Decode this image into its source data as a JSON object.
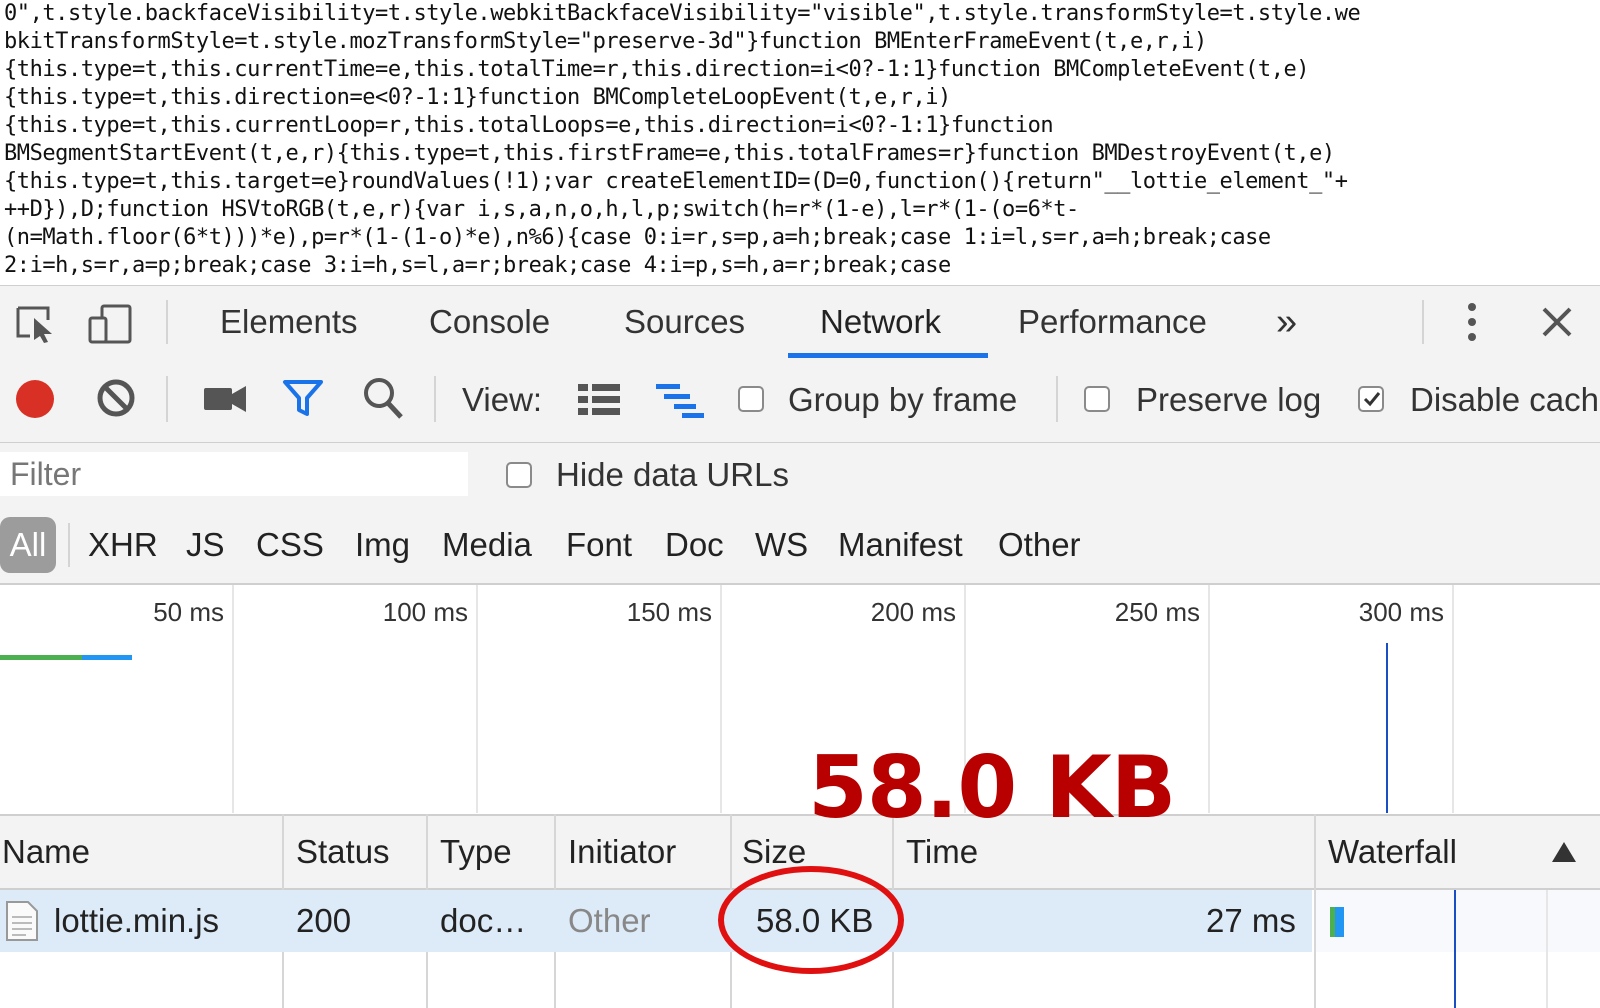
{
  "code_lines": [
    "0\",t.style.backfaceVisibility=t.style.webkitBackfaceVisibility=\"visible\",t.style.transformStyle=t.style.we",
    "bkitTransformStyle=t.style.mozTransformStyle=\"preserve-3d\"}function BMEnterFrameEvent(t,e,r,i)",
    "{this.type=t,this.currentTime=e,this.totalTime=r,this.direction=i<0?-1:1}function BMCompleteEvent(t,e)",
    "{this.type=t,this.direction=e<0?-1:1}function BMCompleteLoopEvent(t,e,r,i)",
    "{this.type=t,this.currentLoop=r,this.totalLoops=e,this.direction=i<0?-1:1}function",
    "BMSegmentStartEvent(t,e,r){this.type=t,this.firstFrame=e,this.totalFrames=r}function BMDestroyEvent(t,e)",
    "{this.type=t,this.target=e}roundValues(!1);var createElementID=(D=0,function(){return\"__lottie_element_\"+",
    "++D}),D;function HSVtoRGB(t,e,r){var i,s,a,n,o,h,l,p;switch(h=r*(1-e),l=r*(1-(o=6*t-",
    "(n=Math.floor(6*t)))*e),p=r*(1-(1-o)*e),n%6){case 0:i=r,s=p,a=h;break;case 1:i=l,s=r,a=h;break;case",
    "2:i=h,s=r,a=p;break;case 3:i=h,s=l,a=r;break;case 4:i=p,s=h,a=r;break;case"
  ],
  "devtools": {
    "tabs": [
      "Elements",
      "Console",
      "Sources",
      "Network",
      "Performance"
    ],
    "active_tab": "Network",
    "more_tabs_glyph": "»"
  },
  "toolbar": {
    "view_label": "View:",
    "group_by_frame": "Group by frame",
    "preserve_log": "Preserve log",
    "disable_cache": "Disable cach",
    "disable_cache_checked": true
  },
  "filter": {
    "placeholder": "Filter",
    "hide_data_urls": "Hide data URLs"
  },
  "type_filters": [
    "All",
    "XHR",
    "JS",
    "CSS",
    "Img",
    "Media",
    "Font",
    "Doc",
    "WS",
    "Manifest",
    "Other"
  ],
  "timeline": {
    "ticks": [
      "50 ms",
      "100 ms",
      "150 ms",
      "200 ms",
      "250 ms",
      "300 ms"
    ]
  },
  "table": {
    "columns": [
      "Name",
      "Status",
      "Type",
      "Initiator",
      "Size",
      "Time",
      "Waterfall"
    ],
    "rows": [
      {
        "name": "lottie.min.js",
        "status": "200",
        "type": "doc…",
        "initiator": "Other",
        "size": "58.0 KB",
        "time": "27 ms"
      }
    ]
  },
  "annotation": {
    "label": "58.0 KB",
    "color": "#b80000"
  },
  "colors": {
    "accent": "#1a73e8",
    "record": "#d93025",
    "annotation_ring": "#e01010"
  }
}
